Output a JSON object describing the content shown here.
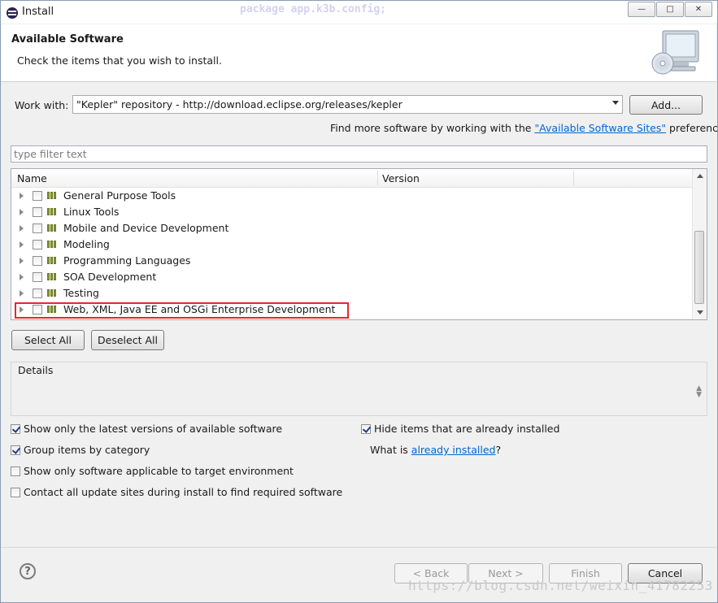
{
  "window": {
    "title": "Install",
    "background_code": "package app.k3b.config;"
  },
  "header": {
    "title": "Available Software",
    "subtitle": "Check the items that you wish to install."
  },
  "work_with": {
    "label": "Work with:",
    "value": "\"Kepler\" repository - http://download.eclipse.org/releases/kepler",
    "add_button": "Add...",
    "hint_prefix": "Find more software by working with the ",
    "hint_link": "\"Available Software Sites\"",
    "hint_suffix": " preferences."
  },
  "filter": {
    "placeholder": "type filter text"
  },
  "table": {
    "columns": [
      "Name",
      "Version"
    ],
    "rows": [
      {
        "label": "General Purpose Tools"
      },
      {
        "label": "Linux Tools"
      },
      {
        "label": "Mobile and Device Development"
      },
      {
        "label": "Modeling"
      },
      {
        "label": "Programming Languages"
      },
      {
        "label": "SOA Development"
      },
      {
        "label": "Testing"
      },
      {
        "label": "Web, XML, Java EE and OSGi Enterprise Development"
      }
    ]
  },
  "selection_buttons": {
    "select_all": "Select All",
    "deselect_all": "Deselect All"
  },
  "details": {
    "title": "Details"
  },
  "options": {
    "latest_versions": {
      "label": "Show only the latest versions of available software",
      "checked": true
    },
    "group_by_category": {
      "label": "Group items by category",
      "checked": true
    },
    "target_env": {
      "label": "Show only software applicable to target environment",
      "checked": false
    },
    "contact_sites": {
      "label": "Contact all update sites during install to find required software",
      "checked": false
    },
    "hide_installed": {
      "label": "Hide items that are already installed",
      "checked": true
    },
    "what_is_prefix": "What is ",
    "what_is_link": "already installed",
    "what_is_suffix": "?"
  },
  "footer": {
    "back": "< Back",
    "next": "Next >",
    "finish": "Finish",
    "cancel": "Cancel",
    "watermark": "https://blog.csdn.net/weixin_41782253"
  },
  "colors": {
    "link": "#0066cc",
    "highlight_box": "#e8262e"
  }
}
